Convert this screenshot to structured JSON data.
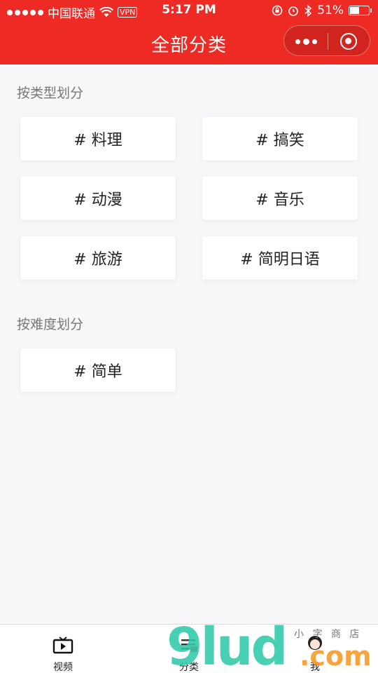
{
  "status_bar": {
    "carrier": "中国联通",
    "vpn": "VPN",
    "time": "5:17 PM",
    "battery_text": "51%",
    "battery_level": 0.51
  },
  "nav": {
    "title": "全部分类"
  },
  "sections": {
    "by_type": {
      "title": "按类型划分",
      "tags": [
        "# 料理",
        "# 搞笑",
        "# 动漫",
        "# 音乐",
        "# 旅游",
        "# 简明日语"
      ]
    },
    "by_difficulty": {
      "title": "按难度划分",
      "tags": [
        "# 简单"
      ]
    }
  },
  "tabbar": {
    "items": [
      {
        "label": "视频",
        "icon": "tv-play-icon"
      },
      {
        "label": "分类",
        "icon": "category-list-icon"
      },
      {
        "label": "我",
        "icon": "user-avatar-icon"
      }
    ]
  },
  "watermark": {
    "main": "9lud",
    "domain": ".com",
    "small": "小 字 商 店"
  },
  "colors": {
    "brand_red": "#ee2a24",
    "background": "#f7f7f9"
  }
}
